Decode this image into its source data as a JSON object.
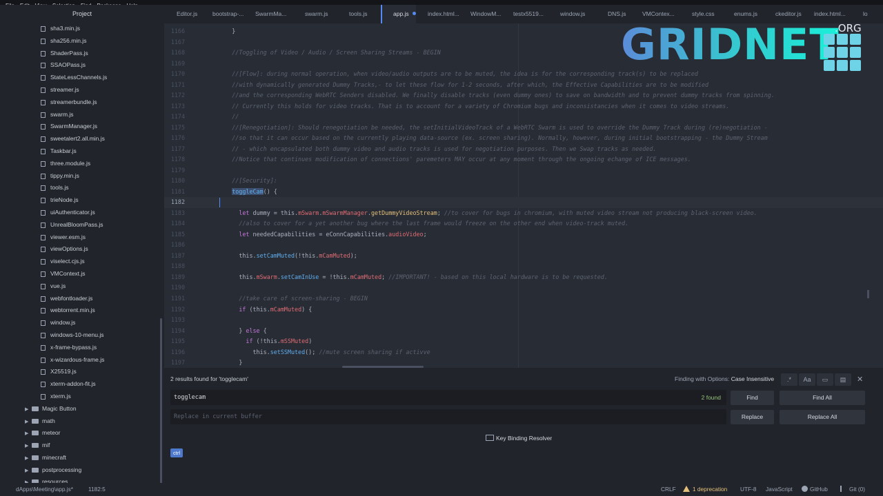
{
  "menu": [
    "File",
    "Edit",
    "View",
    "Selection",
    "Find",
    "Packages",
    "Help"
  ],
  "sidebar": {
    "title": "Project",
    "files": [
      "sha3.min.js",
      "sha256.min.js",
      "ShaderPass.js",
      "SSAOPass.js",
      "StateLessChannels.js",
      "streamer.js",
      "streamerbundle.js",
      "swarm.js",
      "SwarmManager.js",
      "sweetalert2.all.min.js",
      "Taskbar.js",
      "three.module.js",
      "tippy.min.js",
      "tools.js",
      "trieNode.js",
      "uiAuthenticator.js",
      "UnrealBloomPass.js",
      "viewer.esm.js",
      "viewOptions.js",
      "viselect.cjs.js",
      "VMContext.js",
      "vue.js",
      "webfontloader.js",
      "webtorrent.min.js",
      "window.js",
      "windows-10-menu.js",
      "x-frame-bypass.js",
      "x-wizardous-frame.js",
      "X25519.js",
      "xterm-addon-fit.js",
      "xterm.js"
    ],
    "folders": [
      "Magic Button",
      "math",
      "meteor",
      "mif",
      "minecraft",
      "postprocessing",
      "resources"
    ]
  },
  "tabs": [
    "Editor.js",
    "bootstrap-...",
    "SwarmMa...",
    "swarm.js",
    "tools.js",
    "app.js",
    "index.html...",
    "WindowM...",
    "testx5519...",
    "window.js",
    "DNS.js",
    "VMContex...",
    "style.css",
    "enums.js",
    "ckeditor.js",
    "index.html...",
    "lo"
  ],
  "active_tab": "app.js",
  "editor": {
    "lines": [
      {
        "n": "1166",
        "cls": "",
        "t": [
          {
            "c": "",
            "s": "      }"
          }
        ]
      },
      {
        "n": "1167",
        "t": []
      },
      {
        "n": "1168",
        "t": [
          {
            "c": "c-cmt",
            "s": "      //Toggling of Video / Audio / Screen Sharing Streams - BEGIN"
          }
        ]
      },
      {
        "n": "1169",
        "t": []
      },
      {
        "n": "1170",
        "t": [
          {
            "c": "c-cmt",
            "s": "      //[Flow]: during normal operation, when video/audio outputs are to be muted, the idea is for the corresponding track(s) to be replaced"
          }
        ]
      },
      {
        "n": "1171",
        "t": [
          {
            "c": "c-cmt",
            "s": "      //with dynamically generated Dummy Tracks,- to let these flow for 1-2 seconds, after which, the Effective Capabilities are to be modified"
          }
        ]
      },
      {
        "n": "1172",
        "t": [
          {
            "c": "c-cmt",
            "s": "      //and the corresponding WebRTC Senders disabled. We finally disable tracks (even dummy ones) to save on bandwidth and to prevent dummy tracks from spinning."
          }
        ]
      },
      {
        "n": "1173",
        "t": [
          {
            "c": "c-cmt",
            "s": "      // Currently this holds for video tracks. That is to account for a variety of Chromium bugs and inconsistancies when it comes to video streams."
          }
        ]
      },
      {
        "n": "1174",
        "t": [
          {
            "c": "c-cmt",
            "s": "      //"
          }
        ]
      },
      {
        "n": "1175",
        "t": [
          {
            "c": "c-cmt",
            "s": "      //[Renegotiation]: Should renegotiation be needed, the setInitialVideoTrack of a WebRTC Swarm is used to override the Dummy Track during (re)negotiation -"
          }
        ]
      },
      {
        "n": "1176",
        "t": [
          {
            "c": "c-cmt",
            "s": "      //so that it can occur based on the currently playing data-source (ex. screen sharing). Normally, however, during initial bootstrapping - the Dummy Stream"
          }
        ]
      },
      {
        "n": "1177",
        "t": [
          {
            "c": "c-cmt",
            "s": "      // - which encapsulated both dummy video and audio tracks is used for negotiation purposes. Then we Swap tracks as needed."
          }
        ]
      },
      {
        "n": "1178",
        "t": [
          {
            "c": "c-cmt",
            "s": "      //Notice that continues modification of connections' paremeters MAY occur at any moment through the ongoing echange of ICE messages."
          }
        ]
      },
      {
        "n": "1179",
        "t": []
      },
      {
        "n": "1180",
        "t": [
          {
            "c": "c-cmt",
            "s": "      //[Security]:"
          }
        ]
      },
      {
        "n": "1181",
        "t": [
          {
            "c": "",
            "s": "      "
          },
          {
            "c": "c-fn hl",
            "s": "toggleCam"
          },
          {
            "c": "",
            "s": "() {"
          }
        ]
      },
      {
        "n": "1182",
        "cls": "cur",
        "t": []
      },
      {
        "n": "1183",
        "t": [
          {
            "c": "",
            "s": "        "
          },
          {
            "c": "c-kw",
            "s": "let"
          },
          {
            "c": "",
            "s": " dummy = this."
          },
          {
            "c": "c-prop",
            "s": "mSwarm"
          },
          {
            "c": "",
            "s": "."
          },
          {
            "c": "c-prop",
            "s": "mSwarmManager"
          },
          {
            "c": "",
            "s": "."
          },
          {
            "c": "c-fnc",
            "s": "getDummyVideoStream"
          },
          {
            "c": "",
            "s": "; "
          },
          {
            "c": "c-cmt",
            "s": "//to cover for bugs in chromium, with muted video stream not producing black-screen video."
          }
        ]
      },
      {
        "n": "1184",
        "t": [
          {
            "c": "c-cmt",
            "s": "        //also to cover for a yet another bug where the last frame would freeze on the other end when video-track muted."
          }
        ]
      },
      {
        "n": "1185",
        "t": [
          {
            "c": "",
            "s": "        "
          },
          {
            "c": "c-kw",
            "s": "let"
          },
          {
            "c": "",
            "s": " neededCapabilities = eConnCapabilities."
          },
          {
            "c": "c-prop",
            "s": "audioVideo"
          },
          {
            "c": "",
            "s": ";"
          }
        ]
      },
      {
        "n": "1186",
        "t": []
      },
      {
        "n": "1187",
        "t": [
          {
            "c": "",
            "s": "        this."
          },
          {
            "c": "c-fn",
            "s": "setCamMuted"
          },
          {
            "c": "",
            "s": "(!this."
          },
          {
            "c": "c-prop",
            "s": "mCamMuted"
          },
          {
            "c": "",
            "s": ");"
          }
        ]
      },
      {
        "n": "1188",
        "t": []
      },
      {
        "n": "1189",
        "t": [
          {
            "c": "",
            "s": "        this."
          },
          {
            "c": "c-prop",
            "s": "mSwarm"
          },
          {
            "c": "",
            "s": "."
          },
          {
            "c": "c-fn",
            "s": "setCamInUse"
          },
          {
            "c": "",
            "s": " = !this."
          },
          {
            "c": "c-prop",
            "s": "mCamMuted"
          },
          {
            "c": "",
            "s": "; "
          },
          {
            "c": "c-cmt",
            "s": "//IMPORTANT! - based on this local hardware is to be requested."
          }
        ]
      },
      {
        "n": "1190",
        "t": []
      },
      {
        "n": "1191",
        "t": [
          {
            "c": "c-cmt",
            "s": "        //take care of screen-sharing - BEGIN"
          }
        ]
      },
      {
        "n": "1192",
        "t": [
          {
            "c": "",
            "s": "        "
          },
          {
            "c": "c-kw",
            "s": "if"
          },
          {
            "c": "",
            "s": " (this."
          },
          {
            "c": "c-prop",
            "s": "mCamMuted"
          },
          {
            "c": "",
            "s": ") {"
          }
        ]
      },
      {
        "n": "1193",
        "t": []
      },
      {
        "n": "1194",
        "t": [
          {
            "c": "",
            "s": "        } "
          },
          {
            "c": "c-kw",
            "s": "else"
          },
          {
            "c": "",
            "s": " {"
          }
        ]
      },
      {
        "n": "1195",
        "t": [
          {
            "c": "",
            "s": "          "
          },
          {
            "c": "c-kw",
            "s": "if"
          },
          {
            "c": "",
            "s": " (!this."
          },
          {
            "c": "c-prop",
            "s": "mSSMuted"
          },
          {
            "c": "",
            "s": ")"
          }
        ]
      },
      {
        "n": "1196",
        "t": [
          {
            "c": "",
            "s": "            this."
          },
          {
            "c": "c-fn",
            "s": "setSSMuted"
          },
          {
            "c": "",
            "s": "(); "
          },
          {
            "c": "c-cmt",
            "s": "//mute screen sharing if activve"
          }
        ]
      },
      {
        "n": "1197",
        "t": [
          {
            "c": "",
            "s": "        }"
          }
        ]
      }
    ]
  },
  "logo": {
    "text": "GRIDNET",
    "suffix": ".ORG"
  },
  "find": {
    "summary": "2 results found for 'togglecam'",
    "options_label": "Finding with Options:",
    "options_value": "Case Insensitive",
    "opt_regex": ".*",
    "opt_case": "Aa",
    "search_value": "togglecam",
    "found_count": "2 found",
    "replace_placeholder": "Replace in current buffer",
    "find_label": "Find",
    "find_all_label": "Find All",
    "replace_label": "Replace",
    "replace_all_label": "Replace All",
    "close_glyph": "✕"
  },
  "keybinding": {
    "label": "Key Binding Resolver",
    "badge": "ctrl"
  },
  "status": {
    "path": "dApps\\Meeting\\app.js*",
    "cursor": "1182:5",
    "line_ending": "CRLF",
    "deprecation": "1 deprecation",
    "encoding": "UTF-8",
    "grammar": "JavaScript",
    "github": "GitHub",
    "git": "Git (0)"
  }
}
